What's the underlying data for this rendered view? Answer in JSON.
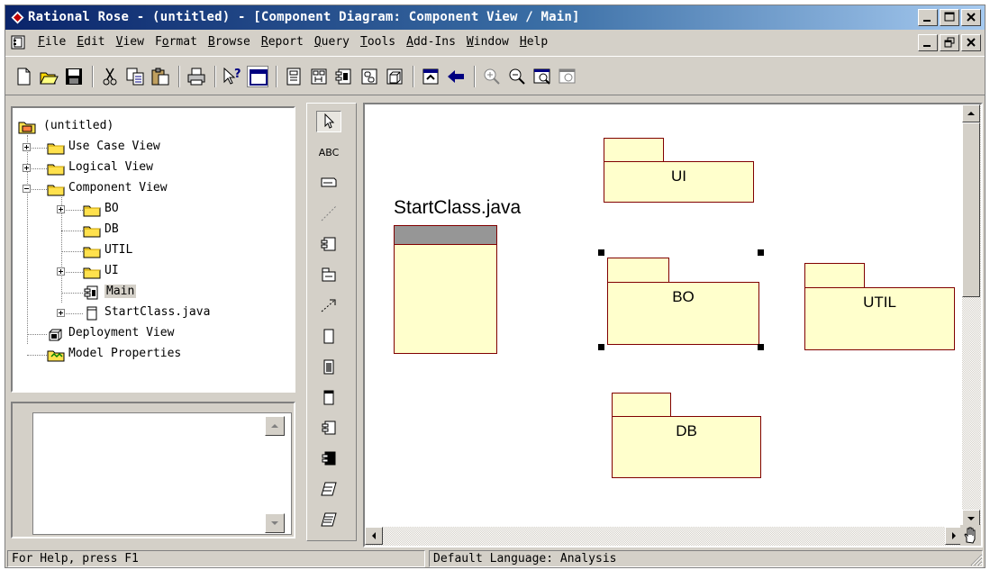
{
  "window": {
    "title": "Rational Rose - (untitled) - [Component Diagram: Component View / Main]"
  },
  "menu": {
    "items": [
      {
        "label": "File",
        "accel": "F"
      },
      {
        "label": "Edit",
        "accel": "E"
      },
      {
        "label": "View",
        "accel": "V"
      },
      {
        "label": "Format",
        "accel": "o"
      },
      {
        "label": "Browse",
        "accel": "B"
      },
      {
        "label": "Report",
        "accel": "R"
      },
      {
        "label": "Query",
        "accel": "Q"
      },
      {
        "label": "Tools",
        "accel": "T"
      },
      {
        "label": "Add-Ins",
        "accel": "A"
      },
      {
        "label": "Window",
        "accel": "W"
      },
      {
        "label": "Help",
        "accel": "H"
      }
    ]
  },
  "toolbar": {
    "icons": [
      "new-icon",
      "open-icon",
      "save-icon",
      "cut-icon",
      "copy-icon",
      "paste-icon",
      "print-icon",
      "context-help-icon",
      "view-doc-icon",
      "browse-class-diagram-icon",
      "browse-interaction-diagram-icon",
      "browse-component-diagram-icon",
      "browse-state-diagram-icon",
      "browse-deployment-diagram-icon",
      "browse-parent-icon",
      "browse-previous-icon",
      "zoom-in-icon",
      "zoom-out-icon",
      "fit-in-window-icon",
      "undo-fit-icon"
    ]
  },
  "browser": {
    "root": "(untitled)",
    "nodes": [
      {
        "label": "Use Case View",
        "icon": "folder-icon"
      },
      {
        "label": "Logical View",
        "icon": "folder-icon"
      },
      {
        "label": "Component View",
        "icon": "folder-icon"
      },
      {
        "label": "BO",
        "icon": "package-folder-icon"
      },
      {
        "label": "DB",
        "icon": "package-folder-icon"
      },
      {
        "label": "UTIL",
        "icon": "package-folder-icon"
      },
      {
        "label": "UI",
        "icon": "package-folder-icon"
      },
      {
        "label": "Main",
        "icon": "component-diagram-icon",
        "selected": true
      },
      {
        "label": "StartClass.java",
        "icon": "component-icon"
      },
      {
        "label": "Deployment View",
        "icon": "deployment-view-icon"
      },
      {
        "label": "Model Properties",
        "icon": "model-properties-icon"
      }
    ]
  },
  "toolbox": {
    "tools": [
      "selection-tool-icon",
      "text-tool-icon",
      "note-tool-icon",
      "anchor-note-tool-icon",
      "component-tool-icon",
      "package-tool-icon",
      "dependency-tool-icon",
      "subprogram-spec-tool-icon",
      "subprogram-body-tool-icon",
      "main-program-tool-icon",
      "package-spec-tool-icon",
      "package-body-tool-icon",
      "task-spec-tool-icon",
      "task-body-tool-icon"
    ],
    "text_tool_label": "ABC"
  },
  "diagram": {
    "packages": [
      {
        "name": "UI"
      },
      {
        "name": "BO",
        "selected": true
      },
      {
        "name": "UTIL"
      },
      {
        "name": "DB"
      }
    ],
    "component": {
      "name": "StartClass.java"
    }
  },
  "status": {
    "help": "For Help, press F1",
    "language": "Default Language: Analysis"
  },
  "colors": {
    "package_fill": "#ffffcc",
    "package_border": "#800000",
    "titlebar": "#0a246a",
    "face": "#d4d0c8"
  }
}
